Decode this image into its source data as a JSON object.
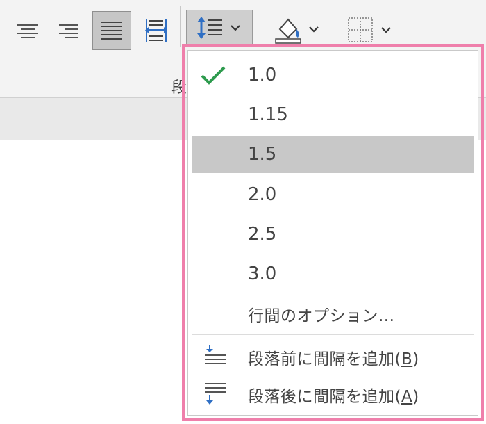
{
  "ribbon": {
    "group_label": "段",
    "tools": [
      {
        "name": "align-center-icon"
      },
      {
        "name": "align-right-icon"
      },
      {
        "name": "justify-icon",
        "pressed": true
      },
      {
        "name": "distributed-icon"
      },
      {
        "name": "line-spacing-icon",
        "pressed": true,
        "has_dropdown": true
      },
      {
        "name": "shading-paint-bucket-icon",
        "has_dropdown": true
      },
      {
        "name": "borders-icon",
        "has_dropdown": true
      }
    ]
  },
  "line_spacing_menu": {
    "options": [
      {
        "label": "1.0",
        "checked": true,
        "selected": false
      },
      {
        "label": "1.15",
        "checked": false,
        "selected": false
      },
      {
        "label": "1.5",
        "checked": false,
        "selected": true
      },
      {
        "label": "2.0",
        "checked": false,
        "selected": false
      },
      {
        "label": "2.5",
        "checked": false,
        "selected": false
      },
      {
        "label": "3.0",
        "checked": false,
        "selected": false
      }
    ],
    "options_label": "行間のオプション...",
    "add_before": {
      "text": "段落前に間隔を追加(",
      "key": "B",
      "close": ")"
    },
    "add_after": {
      "text": "段落後に間隔を追加(",
      "key": "A",
      "close": ")"
    }
  },
  "colors": {
    "check": "#2e9b4e",
    "selected_bg": "#c8c8c8",
    "highlight_border": "#ef7fab",
    "icon_blue": "#2f6fc4"
  }
}
